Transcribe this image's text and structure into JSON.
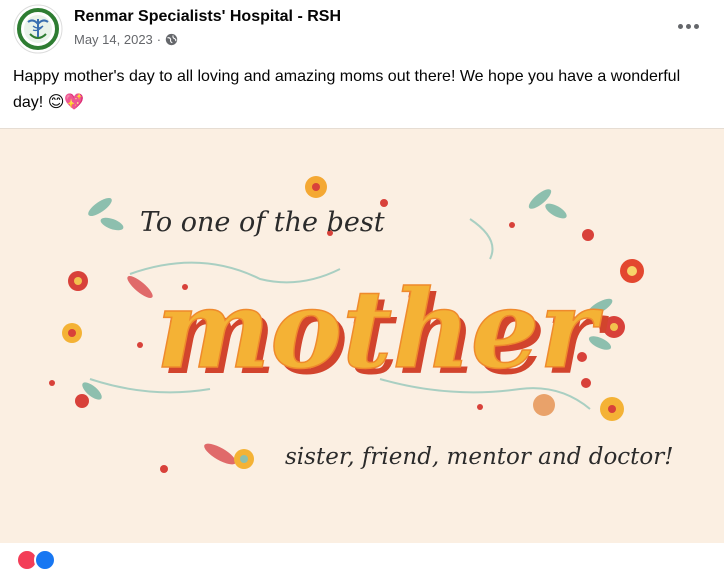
{
  "post": {
    "page_name": "Renmar Specialists' Hospital - RSH",
    "date": "May 14, 2023",
    "separator": "·",
    "text": "Happy mother's day to all loving and amazing moms out there! We hope you have a wonderful day! 😊💖",
    "privacy_icon": "globe-icon",
    "more_icon": "more-options-icon"
  },
  "image": {
    "line1": "To one of the best",
    "main_word": "mother",
    "line3": "sister, friend, mentor and doctor!"
  },
  "colors": {
    "image_background": "#fbefe2",
    "main_word_fill": "#f4b235",
    "main_word_shadow": "#d2442d",
    "brand_green": "#2e7d32"
  }
}
